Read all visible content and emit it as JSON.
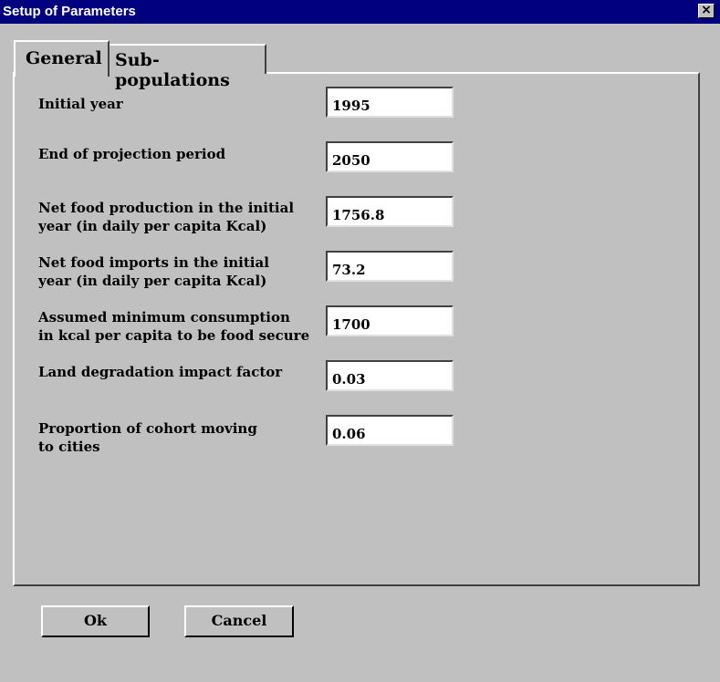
{
  "window": {
    "title": "Setup of Parameters",
    "close_glyph": "×"
  },
  "tabs": [
    {
      "label": "General",
      "active": true
    },
    {
      "label": "Sub-populations",
      "active": false
    }
  ],
  "fields": [
    {
      "label": "Initial year",
      "value": "1995"
    },
    {
      "label": "End of projection period",
      "value": "2050"
    },
    {
      "label": "Net food production  in the initial\nyear (in daily per capita Kcal)",
      "value": "1756.8"
    },
    {
      "label": "Net food imports in the initial\nyear (in daily per capita Kcal)",
      "value": "73.2"
    },
    {
      "label": "Assumed minimum consumption\nin kcal per capita to be food secure",
      "value": "1700"
    },
    {
      "label": "Land degradation impact factor",
      "value": "0.03"
    },
    {
      "label": "Proportion of cohort moving\nto cities",
      "value": "0.06"
    }
  ],
  "buttons": {
    "ok": "Ok",
    "cancel": "Cancel"
  }
}
